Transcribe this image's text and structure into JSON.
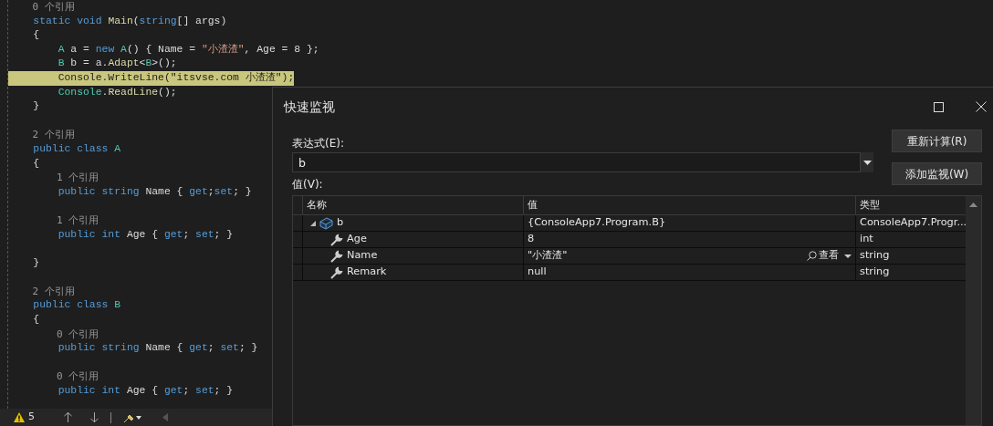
{
  "editor": {
    "lines": [
      {
        "kind": "codelens",
        "text": "    0 个引用"
      },
      {
        "kind": "code",
        "tokens": [
          {
            "text": "    static",
            "kind": "keyword"
          },
          {
            "text": " void",
            "kind": "keyword"
          },
          {
            "text": " Main",
            "kind": "method"
          },
          {
            "text": "(",
            "kind": "plain"
          },
          {
            "text": "string",
            "kind": "keyword"
          },
          {
            "text": "[] args)",
            "kind": "plain"
          }
        ]
      },
      {
        "kind": "code",
        "tokens": [
          {
            "text": "    {",
            "kind": "plain"
          }
        ]
      },
      {
        "kind": "code",
        "tokens": [
          {
            "text": "        A",
            "kind": "type"
          },
          {
            "text": " a = ",
            "kind": "plain"
          },
          {
            "text": "new",
            "kind": "keyword"
          },
          {
            "text": " A",
            "kind": "type"
          },
          {
            "text": "() { Name = ",
            "kind": "plain"
          },
          {
            "text": "\"小渣渣\"",
            "kind": "string"
          },
          {
            "text": ", Age = 8 };",
            "kind": "plain"
          }
        ]
      },
      {
        "kind": "code",
        "tokens": [
          {
            "text": "        B",
            "kind": "type"
          },
          {
            "text": " b = a.",
            "kind": "plain"
          },
          {
            "text": "Adapt",
            "kind": "method"
          },
          {
            "text": "<",
            "kind": "plain"
          },
          {
            "text": "B",
            "kind": "type"
          },
          {
            "text": ">();",
            "kind": "plain"
          }
        ]
      },
      {
        "kind": "code",
        "highlighted": true,
        "tokens": [
          {
            "text": "        Console.WriteLine(\"itsvse.com 小渣渣\");",
            "kind": "plain"
          }
        ]
      },
      {
        "kind": "code",
        "tokens": [
          {
            "text": "        Console",
            "kind": "type"
          },
          {
            "text": ".",
            "kind": "plain"
          },
          {
            "text": "ReadLine",
            "kind": "method"
          },
          {
            "text": "();",
            "kind": "plain"
          }
        ]
      },
      {
        "kind": "code",
        "tokens": [
          {
            "text": "    }",
            "kind": "plain"
          }
        ]
      },
      {
        "kind": "blank"
      },
      {
        "kind": "codelens",
        "text": "    2 个引用"
      },
      {
        "kind": "code",
        "tokens": [
          {
            "text": "    public",
            "kind": "keyword"
          },
          {
            "text": " class",
            "kind": "keyword"
          },
          {
            "text": " A",
            "kind": "type"
          }
        ]
      },
      {
        "kind": "code",
        "tokens": [
          {
            "text": "    {",
            "kind": "plain"
          }
        ]
      },
      {
        "kind": "codelens",
        "text": "        1 个引用"
      },
      {
        "kind": "code",
        "tokens": [
          {
            "text": "        public",
            "kind": "keyword"
          },
          {
            "text": " string",
            "kind": "keyword"
          },
          {
            "text": " Name { ",
            "kind": "plain"
          },
          {
            "text": "get",
            "kind": "keyword"
          },
          {
            "text": ";",
            "kind": "plain"
          },
          {
            "text": "set",
            "kind": "keyword"
          },
          {
            "text": "; }",
            "kind": "plain"
          }
        ]
      },
      {
        "kind": "blank"
      },
      {
        "kind": "codelens",
        "text": "        1 个引用"
      },
      {
        "kind": "code",
        "tokens": [
          {
            "text": "        public",
            "kind": "keyword"
          },
          {
            "text": " int",
            "kind": "keyword"
          },
          {
            "text": " Age { ",
            "kind": "plain"
          },
          {
            "text": "get",
            "kind": "keyword"
          },
          {
            "text": "; ",
            "kind": "plain"
          },
          {
            "text": "set",
            "kind": "keyword"
          },
          {
            "text": "; }",
            "kind": "plain"
          }
        ]
      },
      {
        "kind": "blank"
      },
      {
        "kind": "code",
        "tokens": [
          {
            "text": "    }",
            "kind": "plain"
          }
        ]
      },
      {
        "kind": "blank"
      },
      {
        "kind": "codelens",
        "text": "    2 个引用"
      },
      {
        "kind": "code",
        "tokens": [
          {
            "text": "    public",
            "kind": "keyword"
          },
          {
            "text": " class",
            "kind": "keyword"
          },
          {
            "text": " B",
            "kind": "type"
          }
        ]
      },
      {
        "kind": "code",
        "tokens": [
          {
            "text": "    {",
            "kind": "plain"
          }
        ]
      },
      {
        "kind": "codelens",
        "text": "        0 个引用"
      },
      {
        "kind": "code",
        "tokens": [
          {
            "text": "        public",
            "kind": "keyword"
          },
          {
            "text": " string",
            "kind": "keyword"
          },
          {
            "text": " Name { ",
            "kind": "plain"
          },
          {
            "text": "get",
            "kind": "keyword"
          },
          {
            "text": "; ",
            "kind": "plain"
          },
          {
            "text": "set",
            "kind": "keyword"
          },
          {
            "text": "; }",
            "kind": "plain"
          }
        ]
      },
      {
        "kind": "blank"
      },
      {
        "kind": "codelens",
        "text": "        0 个引用"
      },
      {
        "kind": "code",
        "tokens": [
          {
            "text": "        public",
            "kind": "keyword"
          },
          {
            "text": " int",
            "kind": "keyword"
          },
          {
            "text": " Age { ",
            "kind": "plain"
          },
          {
            "text": "get",
            "kind": "keyword"
          },
          {
            "text": "; ",
            "kind": "plain"
          },
          {
            "text": "set",
            "kind": "keyword"
          },
          {
            "text": "; }",
            "kind": "plain"
          }
        ]
      }
    ]
  },
  "status_bar": {
    "warnings": "5"
  },
  "dialog": {
    "title": "快速监视",
    "expression_label": "表达式(E):",
    "expression": {
      "value": "b"
    },
    "buttons": [
      "重新计算(R)",
      "添加监视(W)"
    ],
    "value_label": "值(V):",
    "table": {
      "columns": [
        "名称",
        "值",
        "类型"
      ],
      "rows": [
        {
          "name": "b",
          "value": "{ConsoleApp7.Program.B}",
          "type": "ConsoleApp7.Progr...",
          "kind": "object",
          "expanded": true,
          "children": [
            {
              "name": "Age",
              "value": "8",
              "type": "int",
              "kind": "property"
            },
            {
              "name": "Name",
              "value": "\"小渣渣\"",
              "type": "string",
              "kind": "property",
              "visualizer": "查看"
            },
            {
              "name": "Remark",
              "value": "null",
              "type": "string",
              "kind": "property"
            }
          ]
        }
      ]
    }
  }
}
